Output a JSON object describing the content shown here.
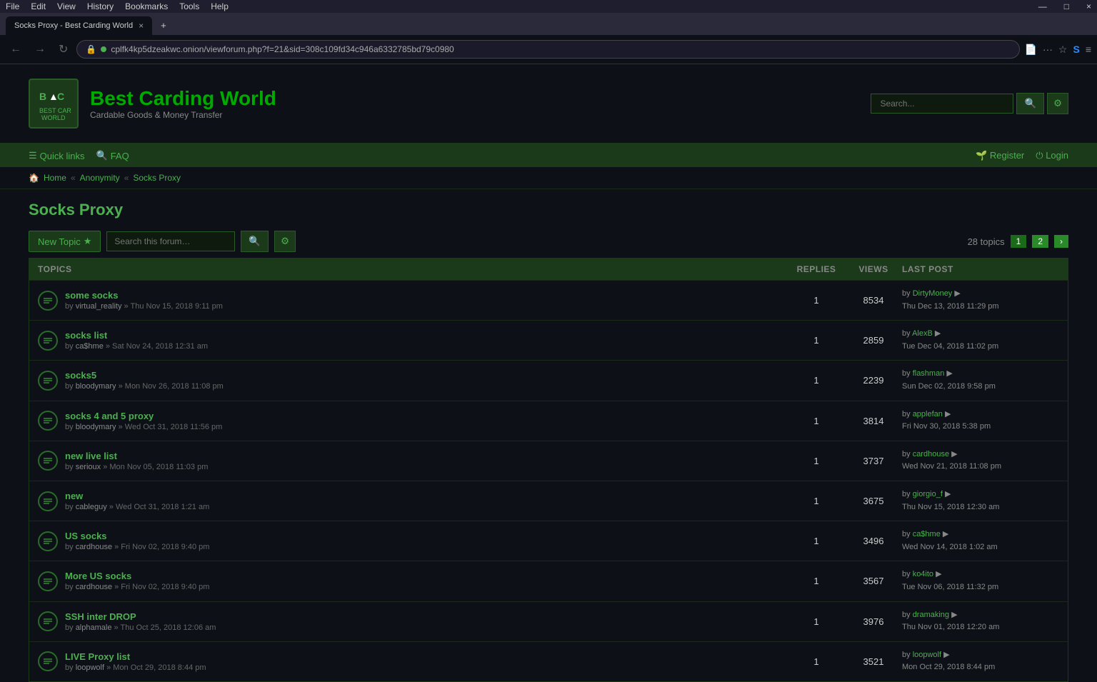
{
  "browser": {
    "menu_items": [
      "File",
      "Edit",
      "View",
      "History",
      "Bookmarks",
      "Tools",
      "Help"
    ],
    "tab_title": "Socks Proxy - Best Carding World",
    "tab_close": "×",
    "tab_new": "+",
    "nav_back": "←",
    "nav_forward": "→",
    "nav_refresh": "↻",
    "address": "cplfk4kp5dzeakwc.onion/viewforum.php?f=21&sid=308c109fd34c946a6332785bd79c0980",
    "window_min": "—",
    "window_max": "□",
    "window_close": "×"
  },
  "site": {
    "title": "Best Carding World",
    "subtitle": "Cardable Goods & Money Transfer",
    "logo_letters": "BCW",
    "search_placeholder": "Search...",
    "search_btn": "🔍",
    "settings_btn": "⚙"
  },
  "nav": {
    "quicklinks": "Quick links",
    "faq": "FAQ",
    "register": "Register",
    "login": "Login"
  },
  "breadcrumb": {
    "home": "Home",
    "sep1": "«",
    "anonymity": "Anonymity",
    "sep2": "«",
    "current": "Socks Proxy"
  },
  "forum": {
    "title": "Socks Proxy",
    "new_topic": "New Topic",
    "new_topic_star": "★",
    "search_placeholder": "Search this forum…",
    "topics_count": "28 topics",
    "page_current": "1",
    "page_next": "2",
    "page_arrow": "›",
    "columns": {
      "topics": "TOPICS",
      "replies": "REPLIES",
      "views": "VIEWS",
      "last_post": "LAST POST"
    },
    "topics": [
      {
        "id": 1,
        "title": "some socks",
        "author": "virtual_reality",
        "date": "Thu Nov 15, 2018 9:11 pm",
        "replies": "1",
        "views": "8534",
        "last_by": "DirtyMoney",
        "last_date": "Thu Dec 13, 2018 11:29 pm"
      },
      {
        "id": 2,
        "title": "socks list",
        "author": "ca$hme",
        "date": "Sat Nov 24, 2018 12:31 am",
        "replies": "1",
        "views": "2859",
        "last_by": "AlexB",
        "last_date": "Tue Dec 04, 2018 11:02 pm"
      },
      {
        "id": 3,
        "title": "socks5",
        "author": "bloodymary",
        "date": "Mon Nov 26, 2018 11:08 pm",
        "replies": "1",
        "views": "2239",
        "last_by": "flashman",
        "last_date": "Sun Dec 02, 2018 9:58 pm"
      },
      {
        "id": 4,
        "title": "socks 4 and 5 proxy",
        "author": "bloodymary",
        "date": "Wed Oct 31, 2018 11:56 pm",
        "replies": "1",
        "views": "3814",
        "last_by": "applefan",
        "last_date": "Fri Nov 30, 2018 5:38 pm"
      },
      {
        "id": 5,
        "title": "new live list",
        "author": "serioux",
        "date": "Mon Nov 05, 2018 11:03 pm",
        "replies": "1",
        "views": "3737",
        "last_by": "cardhouse",
        "last_date": "Wed Nov 21, 2018 11:08 pm"
      },
      {
        "id": 6,
        "title": "new",
        "author": "cableguy",
        "date": "Wed Oct 31, 2018 1:21 am",
        "replies": "1",
        "views": "3675",
        "last_by": "giorgio_f",
        "last_date": "Thu Nov 15, 2018 12:30 am"
      },
      {
        "id": 7,
        "title": "US socks",
        "author": "cardhouse",
        "date": "Fri Nov 02, 2018 9:40 pm",
        "replies": "1",
        "views": "3496",
        "last_by": "ca$hme",
        "last_date": "Wed Nov 14, 2018 1:02 am"
      },
      {
        "id": 8,
        "title": "More US socks",
        "author": "cardhouse",
        "date": "Fri Nov 02, 2018 9:40 pm",
        "replies": "1",
        "views": "3567",
        "last_by": "ko4ito",
        "last_date": "Tue Nov 06, 2018 11:32 pm"
      },
      {
        "id": 9,
        "title": "SSH inter DROP",
        "author": "alphamale",
        "date": "Thu Oct 25, 2018 12:06 am",
        "replies": "1",
        "views": "3976",
        "last_by": "dramaking",
        "last_date": "Thu Nov 01, 2018 12:20 am"
      },
      {
        "id": 10,
        "title": "LIVE Proxy list",
        "author": "loopwolf",
        "date": "Mon Oct 29, 2018 8:44 pm",
        "replies": "1",
        "views": "3521",
        "last_by": "loopwolf",
        "last_date": "Mon Oct 29, 2018 8:44 pm"
      }
    ]
  }
}
